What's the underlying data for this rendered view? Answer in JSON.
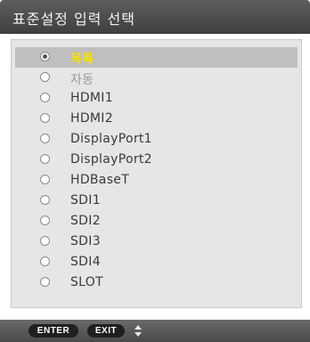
{
  "title": "표준설정 입력 선택",
  "options": [
    {
      "label": "목록",
      "checked": true
    },
    {
      "label": "자동",
      "checked": false
    },
    {
      "label": "HDMI1",
      "checked": false
    },
    {
      "label": "HDMI2",
      "checked": false
    },
    {
      "label": "DisplayPort1",
      "checked": false
    },
    {
      "label": "DisplayPort2",
      "checked": false
    },
    {
      "label": "HDBaseT",
      "checked": false
    },
    {
      "label": "SDI1",
      "checked": false
    },
    {
      "label": "SDI2",
      "checked": false
    },
    {
      "label": "SDI3",
      "checked": false
    },
    {
      "label": "SDI4",
      "checked": false
    },
    {
      "label": "SLOT",
      "checked": false
    }
  ],
  "footer": {
    "enter_label": "ENTER",
    "exit_label": "EXIT",
    "nav_icon": "up-down-arrows-icon"
  },
  "colors": {
    "selected_text": "#f5e000",
    "selected_row": "#bfbfbf"
  }
}
